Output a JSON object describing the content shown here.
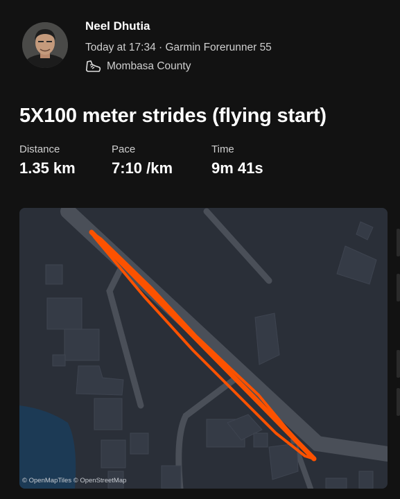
{
  "activity": {
    "athlete_name": "Neel Dhutia",
    "meta": "Today at 17:34 · Garmin Forerunner 55",
    "location": "Mombasa County",
    "title": "5X100 meter strides (flying start)"
  },
  "stats": {
    "distance_label": "Distance",
    "distance_value": "1.35 km",
    "pace_label": "Pace",
    "pace_value": "7:10 /km",
    "time_label": "Time",
    "time_value": "9m 41s"
  },
  "map": {
    "attribution": "© OpenMapTiles © OpenStreetMap",
    "route_color": "#fc5200",
    "background_color": "#2a2f38"
  },
  "icons": {
    "activity_type": "shoe-icon"
  }
}
